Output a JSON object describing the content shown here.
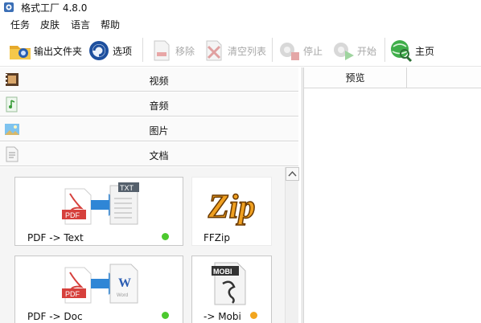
{
  "window": {
    "title": "格式工厂 4.8.0"
  },
  "menu": {
    "items": [
      "任务",
      "皮肤",
      "语言",
      "帮助"
    ]
  },
  "toolbar": {
    "output_folder": "输出文件夹",
    "options": "选项",
    "remove": "移除",
    "clear_list": "清空列表",
    "stop": "停止",
    "start": "开始",
    "home": "主页"
  },
  "categories": [
    {
      "label": "视频",
      "icon": "film-icon"
    },
    {
      "label": "音频",
      "icon": "music-icon"
    },
    {
      "label": "图片",
      "icon": "image-icon"
    },
    {
      "label": "文档",
      "icon": "document-icon"
    }
  ],
  "tools": [
    {
      "name": "PDF -> Text",
      "status": "ready",
      "status_color": "#4cc92e",
      "icon": "pdf-to-txt-icon",
      "badge": "TXT"
    },
    {
      "name": "FFZip",
      "icon": "ffzip-icon",
      "logo": "Zip"
    },
    {
      "name": "PDF -> Doc",
      "status": "ready",
      "status_color": "#4cc92e",
      "icon": "pdf-to-word-icon",
      "badge": "W"
    },
    {
      "name": "-> Mobi",
      "status": "pending",
      "status_color": "#f2a51e",
      "icon": "mobi-icon",
      "badge": "MOBI"
    }
  ],
  "icon_text": {
    "pdf": "PDF",
    "word_sub": "Word"
  },
  "preview": {
    "header": "预览"
  },
  "colors": {
    "pdf_red": "#d6403c",
    "arrow_blue": "#2f86d6",
    "accent_green": "#36a84a"
  }
}
